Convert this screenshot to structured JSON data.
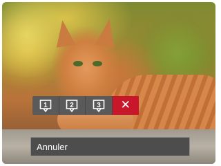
{
  "menu": {
    "items": [
      {
        "label": "1",
        "icon": "frame-1-icon"
      },
      {
        "label": "2",
        "icon": "frame-2-icon"
      },
      {
        "label": "3",
        "icon": "frame-3-icon"
      },
      {
        "label": "✕",
        "icon": "close-icon",
        "selected": true
      }
    ]
  },
  "status": {
    "text": "Annuler"
  },
  "colors": {
    "selected": "#c8162b",
    "menu_bg": "#5a5a5a",
    "status_bg": "#4d4d4d",
    "text": "#ffffff"
  }
}
